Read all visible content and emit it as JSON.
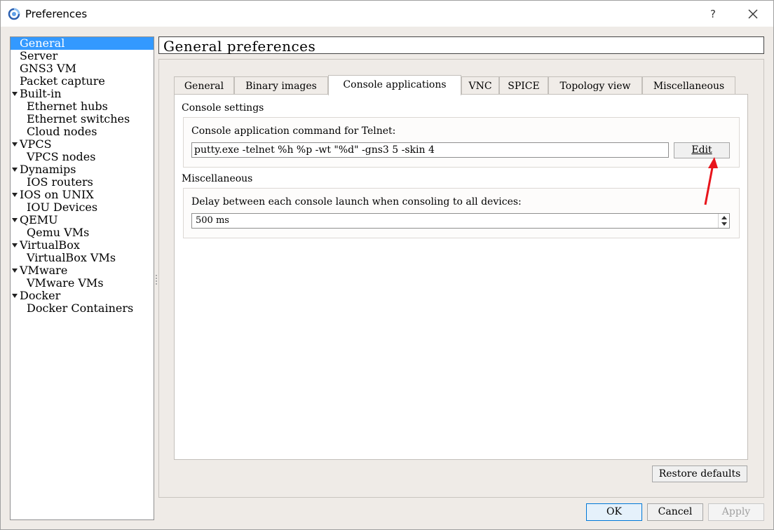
{
  "window": {
    "title": "Preferences",
    "help_label": "?",
    "app_icon": "gns3-logo-icon",
    "close_icon": "close-icon"
  },
  "sidebar": {
    "items": [
      {
        "label": "General",
        "selected": true
      },
      {
        "label": "Server"
      },
      {
        "label": "GNS3 VM"
      },
      {
        "label": "Packet capture"
      },
      {
        "label": "Built-in",
        "expanded": true
      },
      {
        "label": "Ethernet hubs"
      },
      {
        "label": "Ethernet switches"
      },
      {
        "label": "Cloud nodes"
      },
      {
        "label": "VPCS",
        "expanded": true
      },
      {
        "label": "VPCS nodes"
      },
      {
        "label": "Dynamips",
        "expanded": true
      },
      {
        "label": "IOS routers"
      },
      {
        "label": "IOS on UNIX",
        "expanded": true
      },
      {
        "label": "IOU Devices"
      },
      {
        "label": "QEMU",
        "expanded": true
      },
      {
        "label": "Qemu VMs"
      },
      {
        "label": "VirtualBox",
        "expanded": true
      },
      {
        "label": "VirtualBox VMs"
      },
      {
        "label": "VMware",
        "expanded": true
      },
      {
        "label": "VMware VMs"
      },
      {
        "label": "Docker",
        "expanded": true
      },
      {
        "label": "Docker Containers"
      }
    ]
  },
  "main": {
    "header": "General preferences",
    "tabs": [
      {
        "label": "General"
      },
      {
        "label": "Binary images"
      },
      {
        "label": "Console applications",
        "active": true
      },
      {
        "label": "VNC"
      },
      {
        "label": "SPICE"
      },
      {
        "label": "Topology view"
      },
      {
        "label": "Miscellaneous"
      }
    ],
    "console_settings": {
      "title": "Console settings",
      "telnet_label": "Console application command for Telnet:",
      "telnet_value": "putty.exe -telnet %h %p -wt \"%d\" -gns3 5 -skin 4",
      "edit_button": "Edit"
    },
    "misc": {
      "title": "Miscellaneous",
      "delay_label": "Delay between each console launch when consoling to all devices:",
      "delay_value": "500 ms"
    },
    "restore_button": "Restore defaults"
  },
  "footer": {
    "ok": "OK",
    "cancel": "Cancel",
    "apply": "Apply"
  },
  "colors": {
    "selection": "#3399ff",
    "annotation_arrow": "#e8141b",
    "default_button_border": "#0078d7"
  }
}
